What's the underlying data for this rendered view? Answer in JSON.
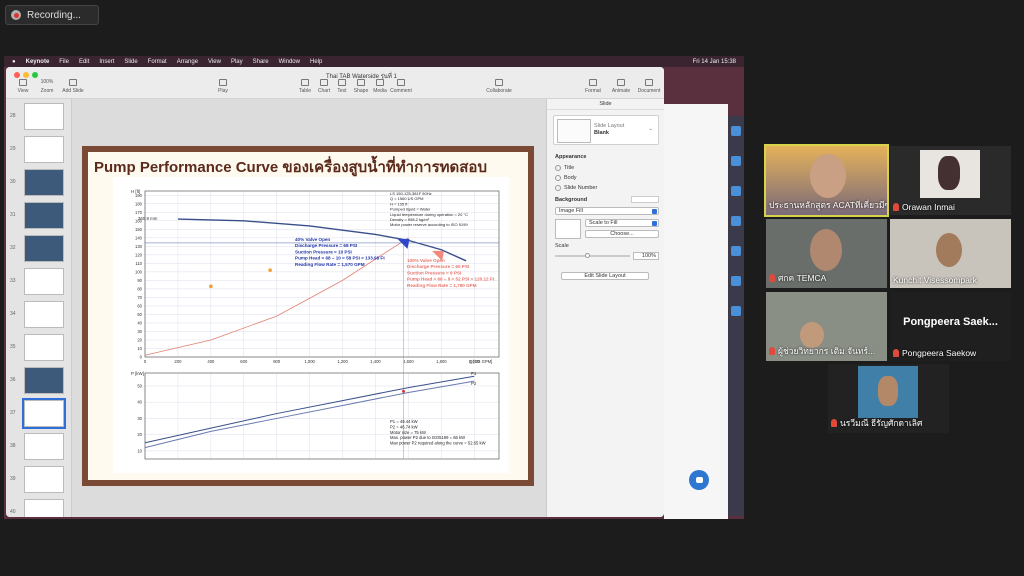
{
  "recording": {
    "label": "Recording..."
  },
  "menubar": {
    "app": "Keynote",
    "items": [
      "File",
      "Edit",
      "Insert",
      "Slide",
      "Format",
      "Arrange",
      "View",
      "Play",
      "Share",
      "Window",
      "Help"
    ],
    "clock": "Fri 14 Jan  15:38"
  },
  "toolbar": {
    "doc_title": "Thai TAB Waterside รุ่นที่ 1",
    "zoom": "100%",
    "buttons": [
      "View",
      "Zoom",
      "Add Slide",
      "Play",
      "Table",
      "Chart",
      "Text",
      "Shape",
      "Media",
      "Comment",
      "Collaborate",
      "Format",
      "Animate",
      "Document"
    ]
  },
  "thumbnails": {
    "numbers": [
      "28",
      "29",
      "30",
      "31",
      "32",
      "33",
      "34",
      "35",
      "36",
      "37",
      "38",
      "39",
      "40"
    ],
    "selected": "37"
  },
  "slide": {
    "title": "Pump Performance Curve ของเครื่องสูบน้ำที่ทำการทดสอบ"
  },
  "chart_data": [
    {
      "type": "line",
      "title": "",
      "xlabel": "Q [US GPM]",
      "ylabel": "H [ft]",
      "x_ticks": [
        0,
        200,
        400,
        600,
        800,
        1000,
        1200,
        1400,
        1600,
        1800,
        2000
      ],
      "x_tick_labels": [
        "0",
        "200",
        "400",
        "600",
        "800",
        "1,000",
        "1,200",
        "1,400",
        "1,600",
        "1,800",
        "2,000"
      ],
      "y_ticks": [
        0,
        10,
        20,
        30,
        40,
        50,
        60,
        70,
        80,
        90,
        100,
        110,
        120,
        130,
        140,
        150,
        160,
        170,
        180,
        190
      ],
      "xlim": [
        0,
        2150
      ],
      "ylim": [
        0,
        195
      ],
      "series": [
        {
          "name": "360.9 mm",
          "x": [
            200,
            600,
            1000,
            1400,
            1600,
            1800,
            1950
          ],
          "y": [
            162,
            160,
            154,
            144,
            137,
            126,
            113
          ]
        },
        {
          "name": "",
          "x": [
            0,
            400,
            800,
            1200,
            1600
          ],
          "y": [
            2,
            20,
            48,
            90,
            140
          ]
        }
      ],
      "points": [
        {
          "x": 400,
          "y": 83
        },
        {
          "x": 760,
          "y": 102
        }
      ],
      "markers": [
        {
          "x": 1570,
          "y": 134
        },
        {
          "x": 1780,
          "y": 120
        }
      ],
      "curve_label": "360.9 mm",
      "info_box": [
        "LS 150-125-381F  50Hz",
        "Q = 1560 US GPM",
        "H = 135 ft",
        "Pumped liquid = Water",
        "Liquid temperature during operation = 20 °C",
        "Density = 998.2 kg/m³",
        "Motor power reserve according to ISO 5199"
      ],
      "annotation_40": [
        "40% Valve Open",
        "Discharge Pressure = 68 PSI",
        "Suction Pressure      = 10 PSI",
        "Pump Head = 68 – 10 = 58 PSI = 133.98 Ft",
        "Reading Flow Rate   = 1,570 GPM"
      ],
      "annotation_100": [
        "100% Valve Open",
        "Discharge Pressure = 60 PSI",
        "Suction Pressure      =  9 PSI",
        "Pump Head = 60 – 9 = 52 PSI = 120.12 Ft",
        "Reading Flow Rate   = 1,780 GPM"
      ]
    },
    {
      "type": "line",
      "title": "",
      "xlabel": "",
      "ylabel": "P [kW]",
      "y_ticks": [
        10,
        20,
        30,
        40,
        50
      ],
      "ylim": [
        5,
        58
      ],
      "xlim": [
        0,
        2150
      ],
      "series": [
        {
          "name": "P1",
          "x": [
            0,
            400,
            800,
            1200,
            1600,
            2000
          ],
          "y": [
            15,
            24,
            33,
            41,
            49,
            56
          ]
        },
        {
          "name": "P2",
          "x": [
            0,
            400,
            800,
            1200,
            1600,
            2000
          ],
          "y": [
            12,
            22,
            30,
            38,
            46,
            53
          ]
        }
      ],
      "info_box": [
        "P1 = 49.44 kW",
        "P2 = 46.74 kW",
        "Motor size = 75 kW",
        "Max. power P2 due to ISO5199 = 66 kW",
        "Max power P2 required along the curve = 52.65 kW"
      ]
    }
  ],
  "inspector": {
    "header": "Slide",
    "layout_label": "Slide Layout",
    "layout_value": "Blank",
    "appearance": "Appearance",
    "checks": [
      "Title",
      "Body",
      "Slide Number"
    ],
    "background": "Background",
    "fill": "Image Fill",
    "scale_mode": "Scale to Fill",
    "choose": "Choose...",
    "scale": "Scale",
    "scale_value": "100%",
    "edit_layout": "Edit Slide Layout"
  },
  "participants": [
    {
      "name": "ประธานหลักสูตร ACATทีเคี่ยวมีซับ",
      "active": true
    },
    {
      "name": "Orawan Inmai"
    },
    {
      "name": "ศกค TEMCA"
    },
    {
      "name": "Kunchit Visessompark"
    },
    {
      "name": "ผู้ช่วยวิทยากร เติม จันทร์..."
    },
    {
      "name": "Pongpeera Saekow",
      "big": "Pongpeera  Saek..."
    },
    {
      "name": "นรวีมณี ธีรัญศักดาเลิศ"
    }
  ]
}
